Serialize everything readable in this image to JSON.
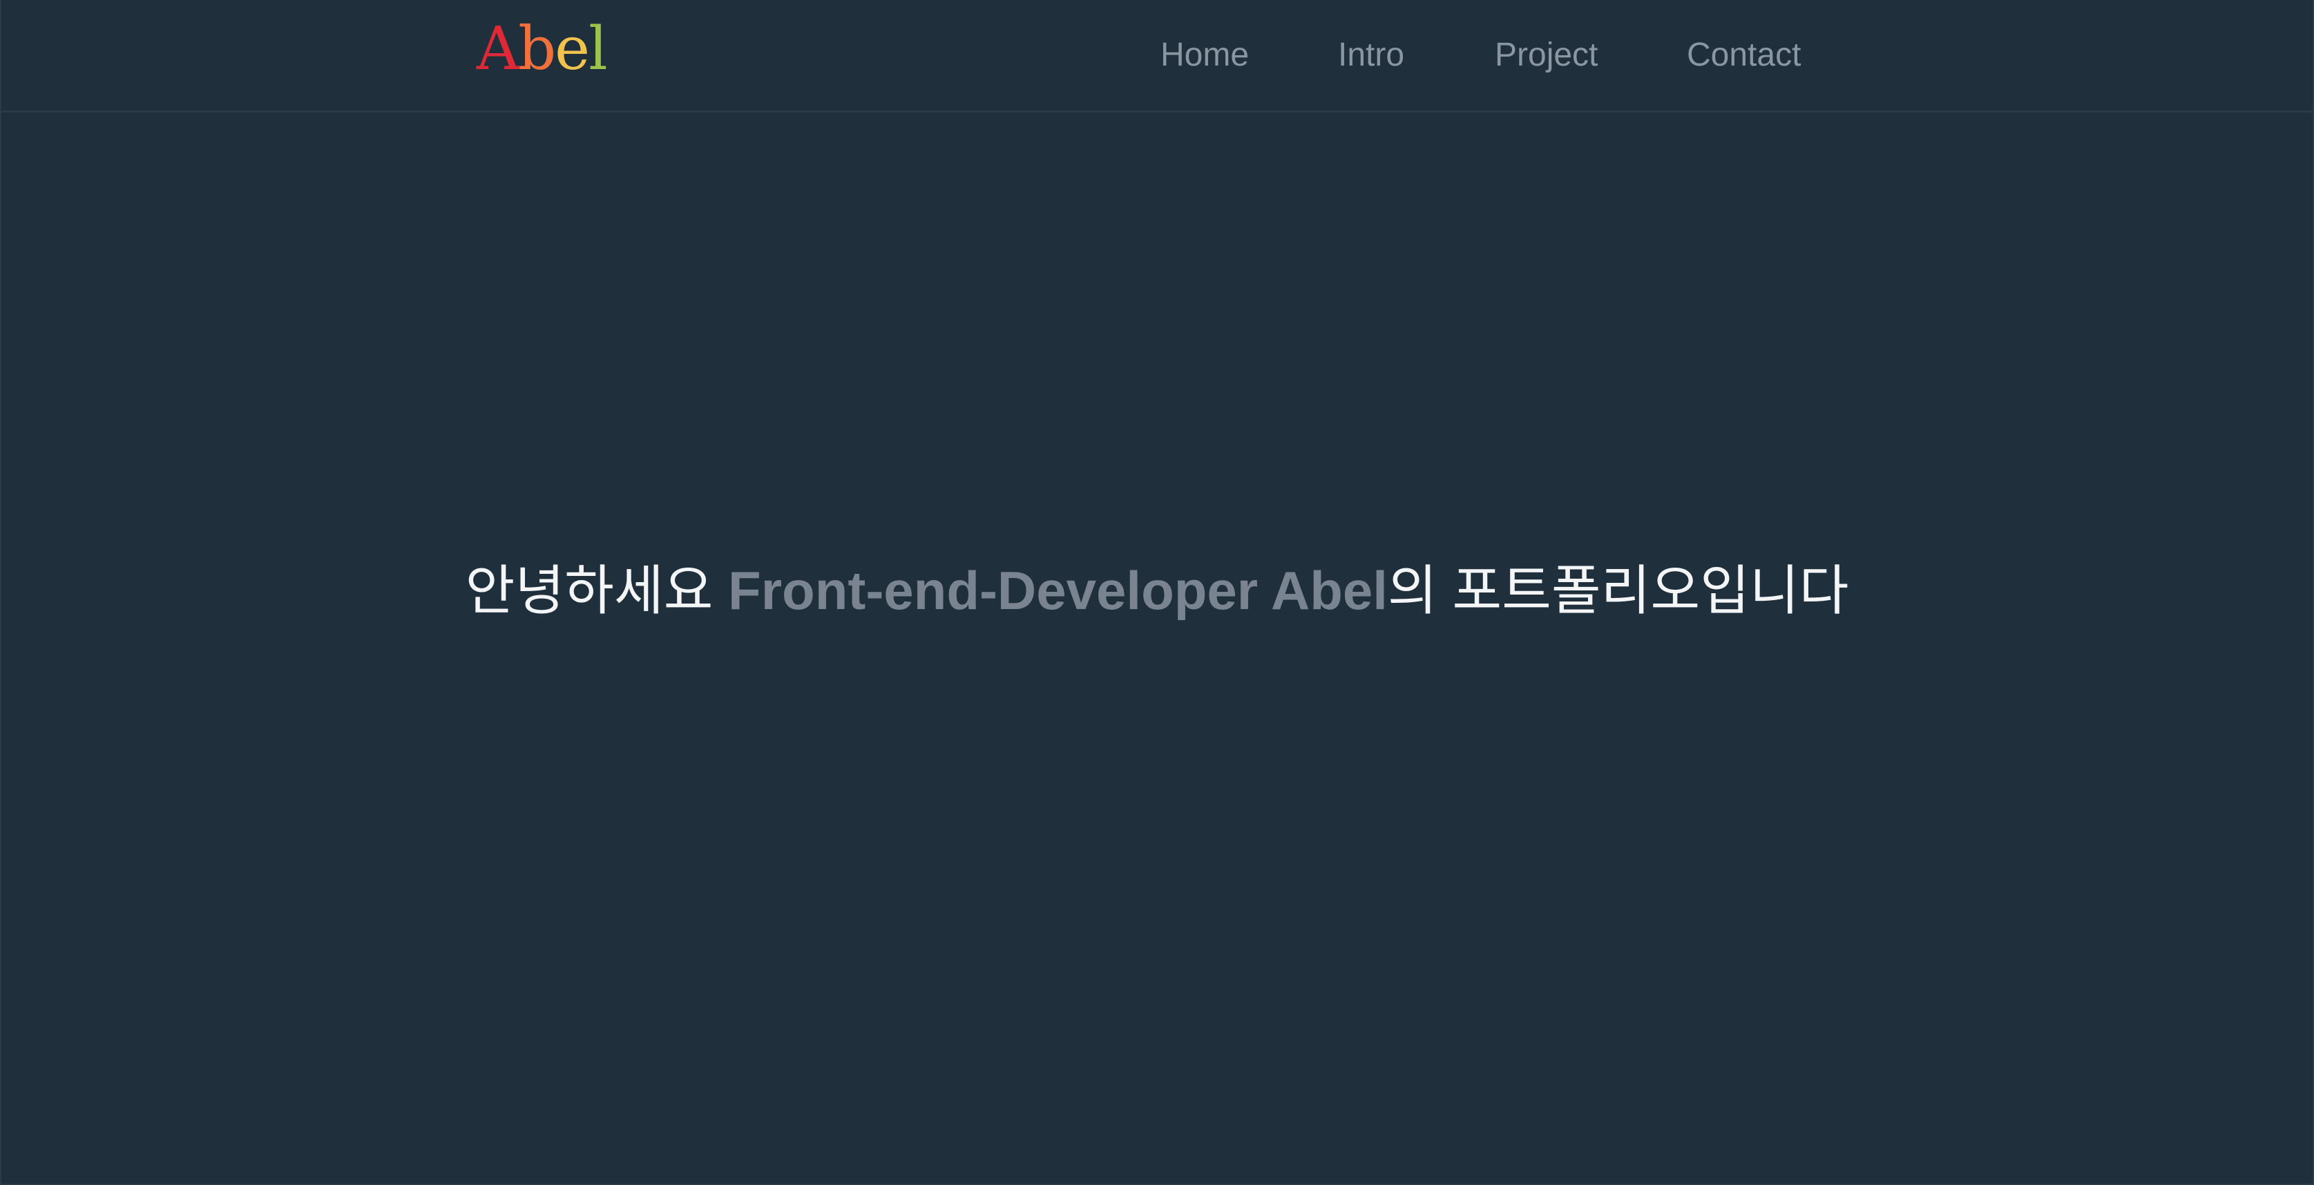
{
  "header": {
    "logo": {
      "text": "Abel",
      "letters": [
        "A",
        "b",
        "e",
        "l"
      ],
      "colors": [
        "#e02937",
        "#f1703b",
        "#f1c34d",
        "#9fc24d"
      ]
    },
    "nav": [
      "Home",
      "Intro",
      "Project",
      "Contact"
    ]
  },
  "hero": {
    "greeting": "안녕하세요 ",
    "highlight": "Front-end-Developer Abel",
    "suffix": "의 포트폴리오입니다"
  },
  "colors": {
    "background": "#1f2f3c",
    "nav_text": "#8a96a1",
    "hero_text": "#f3f5f7",
    "hero_highlight": "#7a8490"
  }
}
